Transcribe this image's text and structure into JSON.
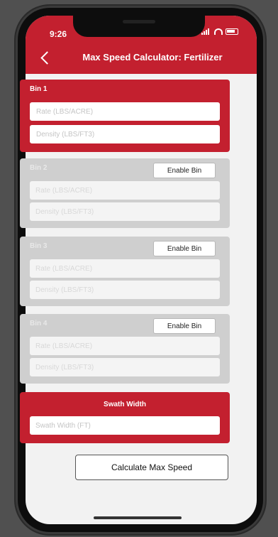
{
  "status": {
    "time": "9:26"
  },
  "header": {
    "title": "Max Speed Calculator: Fertilizer"
  },
  "bins": [
    {
      "label": "Bin 1",
      "rate_placeholder": "Rate (LBS/ACRE)",
      "density_placeholder": "Density (LBS/FT3)",
      "enable_label": ""
    },
    {
      "label": "Bin 2",
      "rate_placeholder": "Rate (LBS/ACRE)",
      "density_placeholder": "Density (LBS/FT3)",
      "enable_label": "Enable Bin"
    },
    {
      "label": "Bin 3",
      "rate_placeholder": "Rate (LBS/ACRE)",
      "density_placeholder": "Density (LBS/FT3)",
      "enable_label": "Enable Bin"
    },
    {
      "label": "Bin 4",
      "rate_placeholder": "Rate (LBS/ACRE)",
      "density_placeholder": "Density (LBS/FT3)",
      "enable_label": "Enable Bin"
    }
  ],
  "swath": {
    "label": "Swath Width",
    "placeholder": "Swath Width (FT)"
  },
  "actions": {
    "calculate_label": "Calculate Max Speed"
  },
  "colors": {
    "accent": "#c3202f",
    "disabled": "#cfcfcf"
  }
}
